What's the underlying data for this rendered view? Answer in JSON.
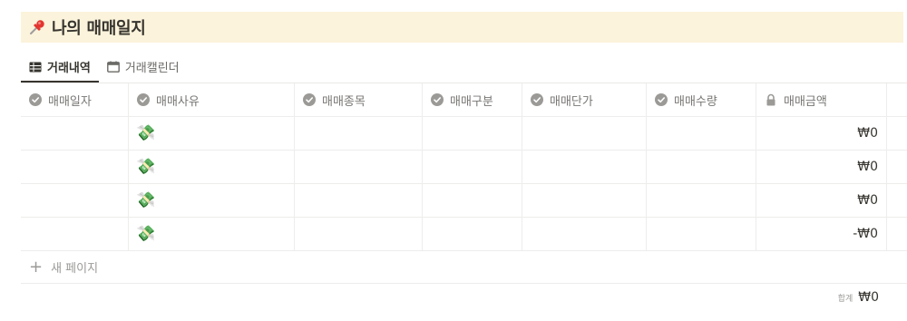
{
  "page": {
    "title": "나의 매매일지",
    "title_icon": "pushpin-icon",
    "title_bg": "#fbf3db"
  },
  "tabs": [
    {
      "label": "거래내역",
      "icon": "table-icon",
      "active": true
    },
    {
      "label": "거래캘린더",
      "icon": "calendar-icon",
      "active": false
    }
  ],
  "columns": [
    {
      "label": "매매일자",
      "icon": "circle-check-icon"
    },
    {
      "label": "매매사유",
      "icon": "circle-check-icon"
    },
    {
      "label": "매매종목",
      "icon": "circle-check-icon"
    },
    {
      "label": "매매구분",
      "icon": "circle-check-icon"
    },
    {
      "label": "매매단가",
      "icon": "circle-check-icon"
    },
    {
      "label": "매매수량",
      "icon": "circle-check-icon"
    },
    {
      "label": "매매금액",
      "icon": "lock-icon"
    }
  ],
  "rows": [
    {
      "reason_icon": "💸",
      "amount": "₩0"
    },
    {
      "reason_icon": "💸",
      "amount": "₩0"
    },
    {
      "reason_icon": "💸",
      "amount": "₩0"
    },
    {
      "reason_icon": "💸",
      "amount": "-₩0"
    }
  ],
  "new_page_label": "새 페이지",
  "summary": {
    "label": "합계",
    "value": "₩0"
  }
}
